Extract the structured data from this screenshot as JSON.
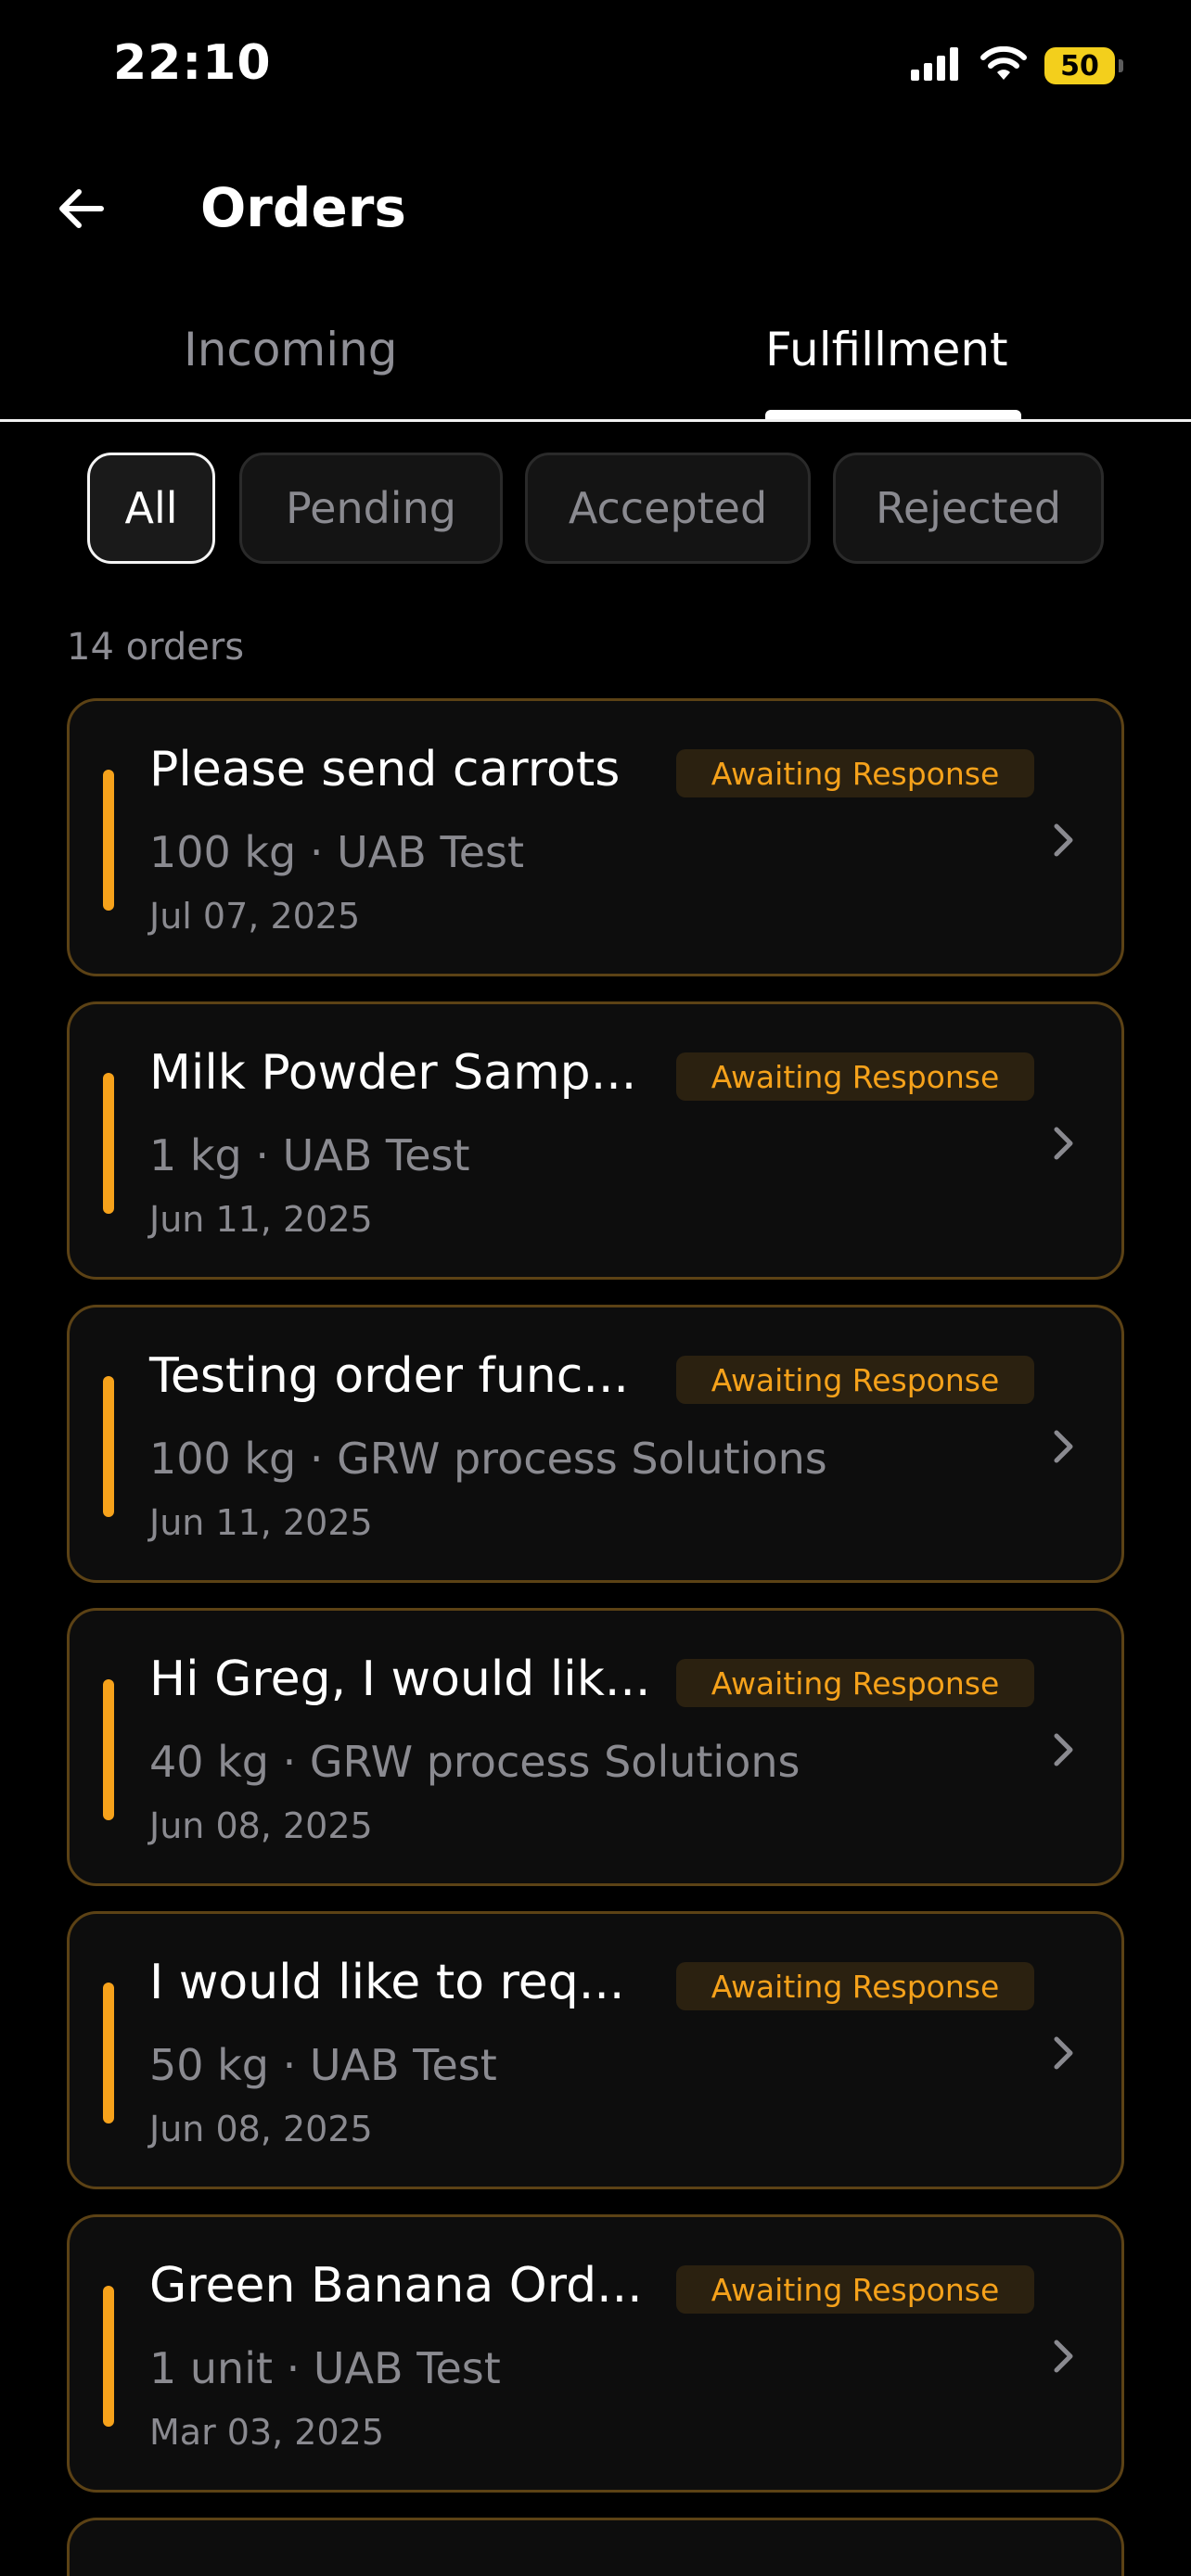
{
  "status_bar": {
    "time": "22:10",
    "battery": "50"
  },
  "header": {
    "title": "Orders",
    "back_icon": "arrow-left-icon"
  },
  "tabs": [
    {
      "label": "Incoming",
      "active": false
    },
    {
      "label": "Fulfillment",
      "active": true
    }
  ],
  "filters": [
    {
      "label": "All",
      "active": true
    },
    {
      "label": "Pending",
      "active": false
    },
    {
      "label": "Accepted",
      "active": false
    },
    {
      "label": "Rejected",
      "active": false
    }
  ],
  "orders_count": "14 orders",
  "colors": {
    "accent": "#f6a21b",
    "card_border": "#5c4215",
    "badge_bg": "#2b2110",
    "muted": "#8a8a90"
  },
  "orders": [
    {
      "title": "Please send carrots",
      "status": "Awaiting Response",
      "meta": "100 kg · UAB Test",
      "date": "Jul 07, 2025"
    },
    {
      "title": "Milk Powder Samp...",
      "status": "Awaiting Response",
      "meta": "1 kg · UAB Test",
      "date": "Jun 11, 2025"
    },
    {
      "title": "Testing order func...",
      "status": "Awaiting Response",
      "meta": "100 kg · GRW process Solutions",
      "date": "Jun 11, 2025"
    },
    {
      "title": "Hi Greg, I would lik...",
      "status": "Awaiting Response",
      "meta": "40 kg · GRW process Solutions",
      "date": "Jun 08, 2025"
    },
    {
      "title": "I would like to req...",
      "status": "Awaiting Response",
      "meta": "50 kg · UAB Test",
      "date": "Jun 08, 2025"
    },
    {
      "title": "Green Banana Ord...",
      "status": "Awaiting Response",
      "meta": "1 unit · UAB Test",
      "date": "Mar 03, 2025"
    }
  ]
}
